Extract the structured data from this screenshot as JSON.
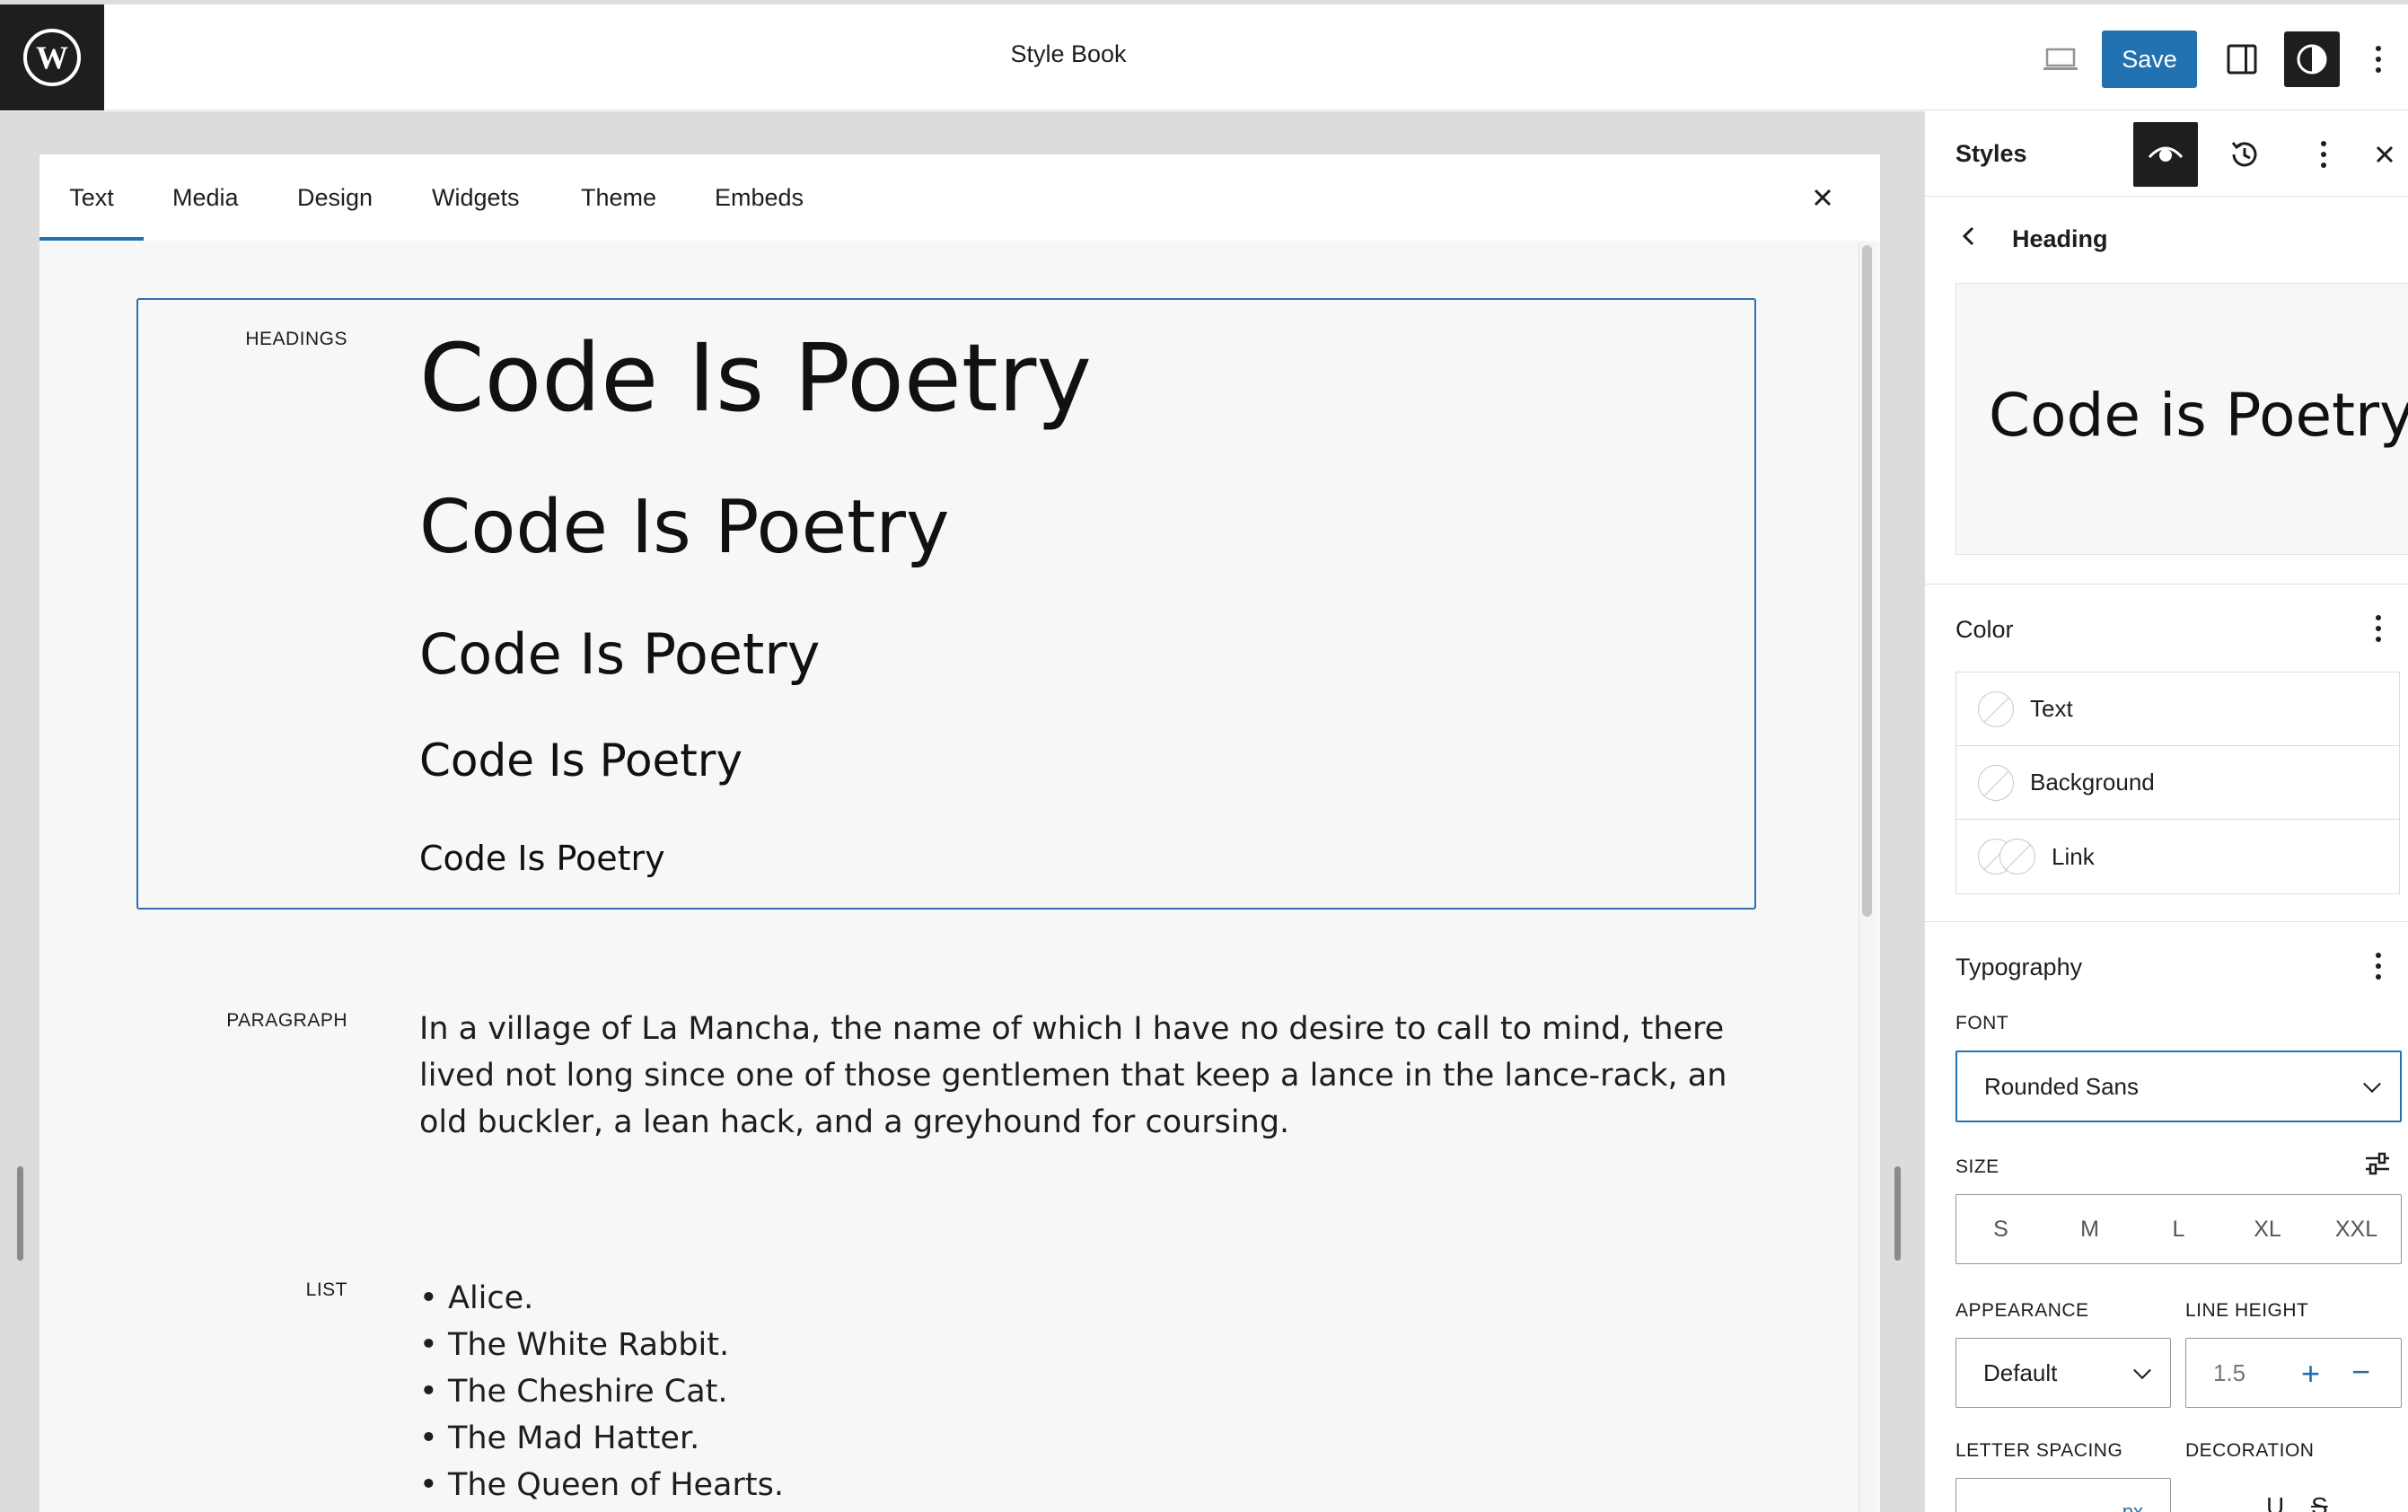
{
  "topbar": {
    "title": "Style Book",
    "save_label": "Save",
    "icons": [
      "wordpress-logo",
      "desktop-preview-icon",
      "sidebar-toggle-icon",
      "styles-contrast-icon",
      "options-kebab-icon"
    ]
  },
  "style_book": {
    "tabs": [
      {
        "label": "Text",
        "active": true
      },
      {
        "label": "Media"
      },
      {
        "label": "Design"
      },
      {
        "label": "Widgets"
      },
      {
        "label": "Theme"
      },
      {
        "label": "Embeds"
      }
    ],
    "sections": {
      "headings_label": "HEADINGS",
      "headings": [
        "Code Is Poetry",
        "Code Is Poetry",
        "Code Is Poetry",
        "Code Is Poetry",
        "Code Is Poetry"
      ],
      "paragraph_label": "PARAGRAPH",
      "paragraph": "In a village of La Mancha, the name of which I have no desire to call to mind, there lived not long since one of those gentlemen that keep a lance in the lance-rack, an old buckler, a lean hack, and a greyhound for coursing.",
      "list_label": "LIST",
      "list": [
        "Alice.",
        "The White Rabbit.",
        "The Cheshire Cat.",
        "The Mad Hatter.",
        "The Queen of Hearts."
      ]
    }
  },
  "panel": {
    "title": "Styles",
    "subtitle": "Heading",
    "preview_text": "Code is Poetry",
    "color": {
      "title": "Color",
      "items": [
        "Text",
        "Background",
        "Link"
      ]
    },
    "typography": {
      "title": "Typography",
      "font_label": "FONT",
      "font_value": "Rounded Sans",
      "size_label": "SIZE",
      "sizes": [
        "S",
        "M",
        "L",
        "XL",
        "XXL"
      ],
      "appearance_label": "APPEARANCE",
      "appearance_value": "Default",
      "line_height_label": "LINE HEIGHT",
      "line_height_value": "1.5",
      "line_height_plus": "+",
      "line_height_minus": "−",
      "letter_spacing_label": "LETTER SPACING",
      "letter_spacing_unit": "px",
      "decoration_label": "DECORATION",
      "decoration_options": [
        "U",
        "S"
      ]
    }
  },
  "colors": {
    "accent": "#2271b1",
    "dark": "#1e1e1e"
  }
}
